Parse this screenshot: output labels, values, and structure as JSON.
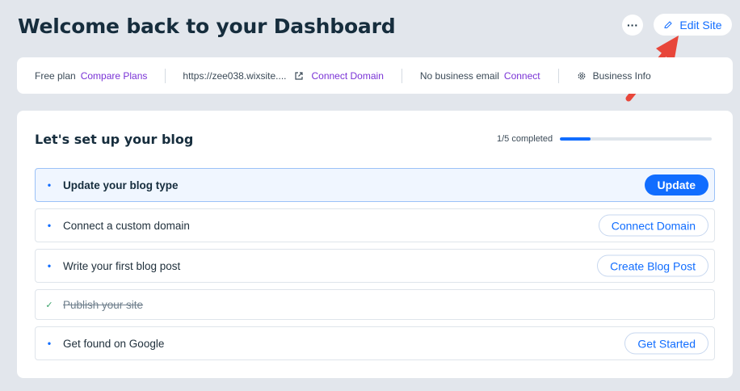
{
  "header": {
    "title": "Welcome back to your Dashboard",
    "more_label": "···",
    "edit_label": "Edit Site"
  },
  "info_bar": {
    "plan": "Free plan",
    "compare_link": "Compare Plans",
    "site_url": "https://zee038.wixsite....",
    "connect_domain_link": "Connect Domain",
    "email_status": "No business email",
    "email_connect_link": "Connect",
    "business_info": "Business Info"
  },
  "setup": {
    "title": "Let's set up your blog",
    "progress_label": "1/5 completed",
    "progress_fraction": 0.2,
    "steps": [
      {
        "label": "Update your blog type",
        "button": "Update",
        "state": "active"
      },
      {
        "label": "Connect a custom domain",
        "button": "Connect Domain",
        "state": "pending"
      },
      {
        "label": "Write your first blog post",
        "button": "Create Blog Post",
        "state": "pending"
      },
      {
        "label": "Publish your site",
        "button": "",
        "state": "done"
      },
      {
        "label": "Get found on Google",
        "button": "Get Started",
        "state": "pending"
      }
    ]
  },
  "colors": {
    "accent": "#116dff",
    "link": "#7a33d6",
    "annotation_arrow": "#e8463a",
    "background": "#e2e6ec"
  }
}
